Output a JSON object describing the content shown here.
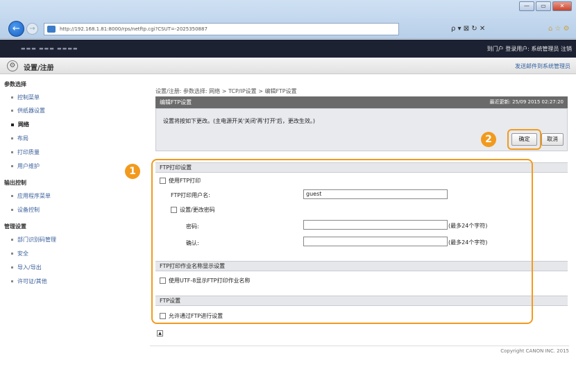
{
  "browser": {
    "address": "http://192.168.1.81:8000/rps/netftp.cgi?CSUT=-2025350887",
    "address_host": "192.168.1.81",
    "search_controls": "ρ ▾ ⊠ ↻ ✕",
    "window_controls": [
      "—",
      "▭",
      "✕"
    ]
  },
  "app": {
    "header_right": "到门户  登录用户: 系统管理员 注销",
    "title": "设置/注册",
    "title_right": "发送邮件到系统管理员"
  },
  "sidebar": {
    "sections": [
      {
        "label": "参数选择",
        "items": [
          {
            "label": "控制菜单"
          },
          {
            "label": "供纸器设置"
          },
          {
            "label": "网络",
            "active": true
          },
          {
            "label": "布局"
          },
          {
            "label": "打印质量"
          },
          {
            "label": "用户维护"
          }
        ]
      },
      {
        "label": "输出控制",
        "items": [
          {
            "label": "应用程序菜单"
          },
          {
            "label": "设备控制"
          }
        ]
      },
      {
        "label": "管理设置",
        "items": [
          {
            "label": "部门识别码管理"
          },
          {
            "label": "安全"
          },
          {
            "label": "导入/导出"
          },
          {
            "label": "许可证/其他"
          }
        ]
      }
    ]
  },
  "main": {
    "breadcrumb": "设置/注册: 参数选择: 网络 > TCP/IP设置 > 编辑FTP设置",
    "panel_title": "编辑FTP设置",
    "last_updated": "最近更新: 25/09 2015 02:27:20",
    "notice": "设置将按如下更改。(主电源开关'关闭'再'打开'后，更改生效。)",
    "ok_label": "确定",
    "cancel_label": "取消",
    "callouts": [
      "1",
      "2"
    ],
    "groups": [
      {
        "title": "FTP打印设置"
      },
      {
        "title": "FTP打印作业名称显示设置"
      },
      {
        "title": "FTP设置"
      }
    ],
    "use_ftp_print": "使用FTP打印",
    "ftp_user_label": "FTP打印用户名:",
    "ftp_user_value": "guest",
    "set_change_password": "设置/更改密码",
    "password_label": "密码:",
    "confirm_label": "确认:",
    "max_hint": "(最多24个字符)",
    "use_utf8": "使用UTF-8显示FTP打印作业名称",
    "allow_ftp_settings": "允许通过FTP进行设置",
    "copyright": "Copyright CANON INC. 2015"
  },
  "colors": {
    "callout": "#f29a1d",
    "header_dark": "#1d2233",
    "panel_header": "#6a6a6a"
  }
}
